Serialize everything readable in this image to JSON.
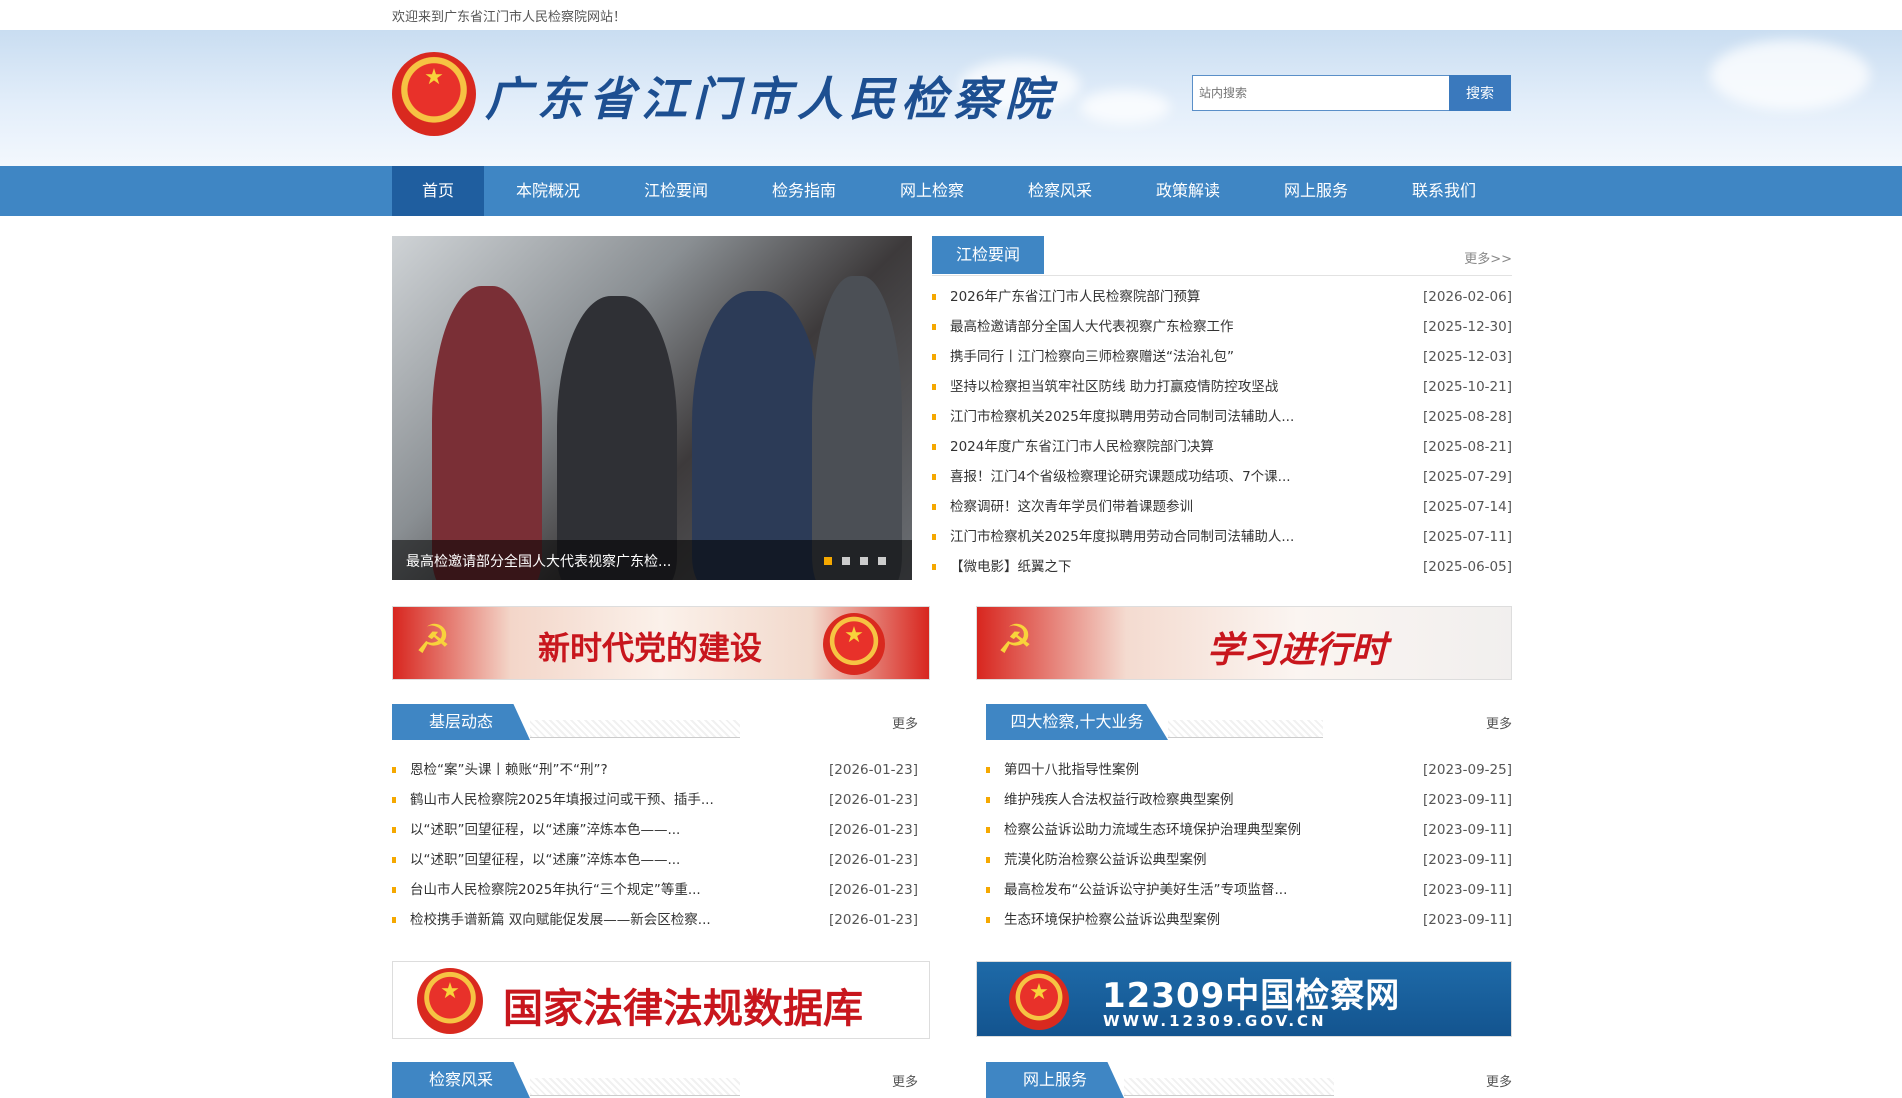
{
  "topbar": {
    "welcome": "欢迎来到广东省江门市人民检察院网站！"
  },
  "header": {
    "title": "广东省江门市人民检察院",
    "search_placeholder": "站内搜索",
    "search_button": "搜索"
  },
  "nav": {
    "items": [
      "首页",
      "本院概况",
      "江检要闻",
      "检务指南",
      "网上检察",
      "检察风采",
      "政策解读",
      "网上服务",
      "联系我们"
    ],
    "active": "首页"
  },
  "slider": {
    "caption": "最高检邀请部分全国人大代表视察广东检...",
    "active_dot": 1,
    "dot_count": 4
  },
  "news": {
    "tab": "江检要闻",
    "more": "更多>>",
    "items": [
      {
        "title": "2026年广东省江门市人民检察院部门预算",
        "date": "[2026-02-06]"
      },
      {
        "title": "最高检邀请部分全国人大代表视察广东检察工作",
        "date": "[2025-12-30]"
      },
      {
        "title": "携手同行丨江门检察向三师检察赠送“法治礼包”",
        "date": "[2025-12-03]"
      },
      {
        "title": "坚持以检察担当筑牢社区防线 助力打赢疫情防控攻坚战",
        "date": "[2025-10-21]"
      },
      {
        "title": "江门市检察机关2025年度拟聘用劳动合同制司法辅助人...",
        "date": "[2025-08-28]"
      },
      {
        "title": "2024年度广东省江门市人民检察院部门决算",
        "date": "[2025-08-21]"
      },
      {
        "title": "喜报！江门4个省级检察理论研究课题成功结项、7个课...",
        "date": "[2025-07-29]"
      },
      {
        "title": "检察调研！这次青年学员们带着课题参训",
        "date": "[2025-07-14]"
      },
      {
        "title": "江门市检察机关2025年度拟聘用劳动合同制司法辅助人...",
        "date": "[2025-07-11]"
      },
      {
        "title": "【微电影】纸翼之下",
        "date": "[2025-06-05]"
      }
    ]
  },
  "banners": {
    "left": "新时代党的建设",
    "right": "学习进行时"
  },
  "grassroots": {
    "tab": "基层动态",
    "more": "更多",
    "items": [
      {
        "title": "恩检“案”头课丨赖账“刑”不“刑”?",
        "date": "[2026-01-23]"
      },
      {
        "title": "鹤山市人民检察院2025年填报过问或干预、插手...",
        "date": "[2026-01-23]"
      },
      {
        "title": "以“述职”回望征程，以“述廉”淬炼本色——...",
        "date": "[2026-01-23]"
      },
      {
        "title": "以“述职”回望征程，以“述廉”淬炼本色——...",
        "date": "[2026-01-23]"
      },
      {
        "title": "台山市人民检察院2025年执行“三个规定”等重...",
        "date": "[2026-01-23]"
      },
      {
        "title": "检校携手谱新篇 双向赋能促发展——新会区检察...",
        "date": "[2026-01-23]"
      }
    ]
  },
  "business": {
    "tab": "四大检察,十大业务",
    "more": "更多",
    "items": [
      {
        "title": "第四十八批指导性案例",
        "date": "[2023-09-25]"
      },
      {
        "title": "维护残疾人合法权益行政检察典型案例",
        "date": "[2023-09-11]"
      },
      {
        "title": "检察公益诉讼助力流域生态环境保护治理典型案例",
        "date": "[2023-09-11]"
      },
      {
        "title": "荒漠化防治检察公益诉讼典型案例",
        "date": "[2023-09-11]"
      },
      {
        "title": "最高检发布“公益诉讼守护美好生活”专项监督...",
        "date": "[2023-09-11]"
      },
      {
        "title": "生态环境保护检察公益诉讼典型案例",
        "date": "[2023-09-11]"
      }
    ]
  },
  "bottom_banners": {
    "left": "国家法律法规数据库",
    "right_main": "12309中国检察网",
    "right_sub": "WWW.12309.GOV.CN"
  },
  "bottom_sections": {
    "left_tab": "检察风采",
    "left_more": "更多",
    "right_tab": "网上服务",
    "right_more": "更多"
  },
  "colors": {
    "nav_bg": "#3f86c4",
    "nav_active": "#1f5e9f",
    "bullet": "#f5a800",
    "title": "#1d4f91"
  }
}
